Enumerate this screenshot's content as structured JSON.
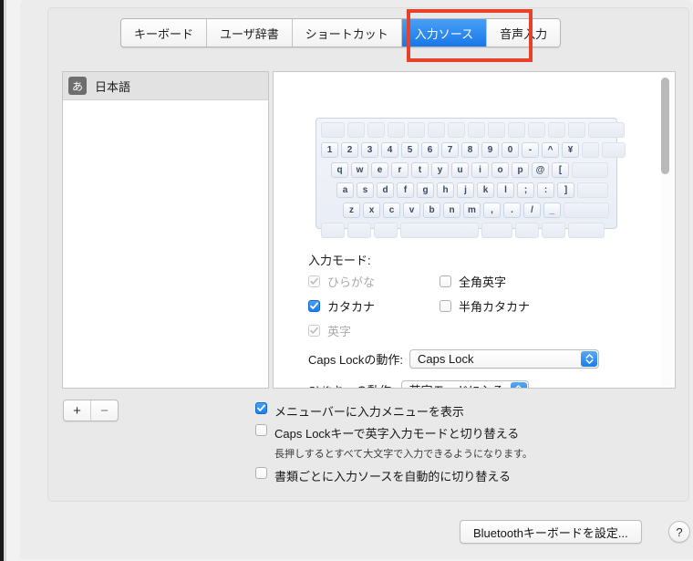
{
  "window": {
    "tabs": [
      {
        "label": "キーボード",
        "active": false
      },
      {
        "label": "ユーザ辞書",
        "active": false
      },
      {
        "label": "ショートカット",
        "active": false
      },
      {
        "label": "入力ソース",
        "active": true
      },
      {
        "label": "音声入力",
        "active": false
      }
    ],
    "annotation_color": "#e8412a",
    "accent_color": "#1a7ef2"
  },
  "source_list": {
    "items": [
      {
        "badge": "あ",
        "label": "日本語"
      }
    ],
    "add_label": "+",
    "remove_label": "−"
  },
  "keyboard_preview": {
    "rows": [
      [
        "",
        "",
        "",
        "",
        "",
        "",
        "",
        "",
        "",
        "",
        "",
        "",
        "",
        ""
      ],
      [
        "1",
        "2",
        "3",
        "4",
        "5",
        "6",
        "7",
        "8",
        "9",
        "0",
        "-",
        "^",
        "¥",
        ""
      ],
      [
        "q",
        "w",
        "e",
        "r",
        "t",
        "y",
        "u",
        "i",
        "o",
        "p",
        "@",
        "["
      ],
      [
        "a",
        "s",
        "d",
        "f",
        "g",
        "h",
        "j",
        "k",
        "l",
        ";",
        ":",
        "]"
      ],
      [
        "z",
        "x",
        "c",
        "v",
        "b",
        "n",
        "m",
        ",",
        ".",
        "/",
        "_"
      ],
      [
        "",
        "",
        "",
        "",
        "",
        "",
        "",
        ""
      ]
    ]
  },
  "input_mode": {
    "title": "入力モード:",
    "options": [
      {
        "label": "ひらがな",
        "checked": true,
        "enabled": false
      },
      {
        "label": "カタカナ",
        "checked": true,
        "enabled": true
      },
      {
        "label": "英字",
        "checked": true,
        "enabled": false
      },
      {
        "label": "全角英字",
        "checked": false,
        "enabled": true
      },
      {
        "label": "半角カタカナ",
        "checked": false,
        "enabled": true
      }
    ]
  },
  "popups": [
    {
      "label": "Caps Lockの動作:",
      "value": "Caps Lock"
    },
    {
      "label": "Shiftキーの動作:",
      "value": "英字モードに入る"
    }
  ],
  "bottom_options": [
    {
      "label": "メニューバーに入力メニューを表示",
      "checked": true
    },
    {
      "label": "Caps Lockキーで英字入力モードと切り替える",
      "checked": false
    },
    {
      "label": "書類ごとに入力ソースを自動的に切り替える",
      "checked": false
    }
  ],
  "bottom_note": "長押しするとすべて大文字で入力できるようになります。",
  "footer": {
    "bluetooth_button": "Bluetoothキーボードを設定...",
    "help_button": "?"
  }
}
